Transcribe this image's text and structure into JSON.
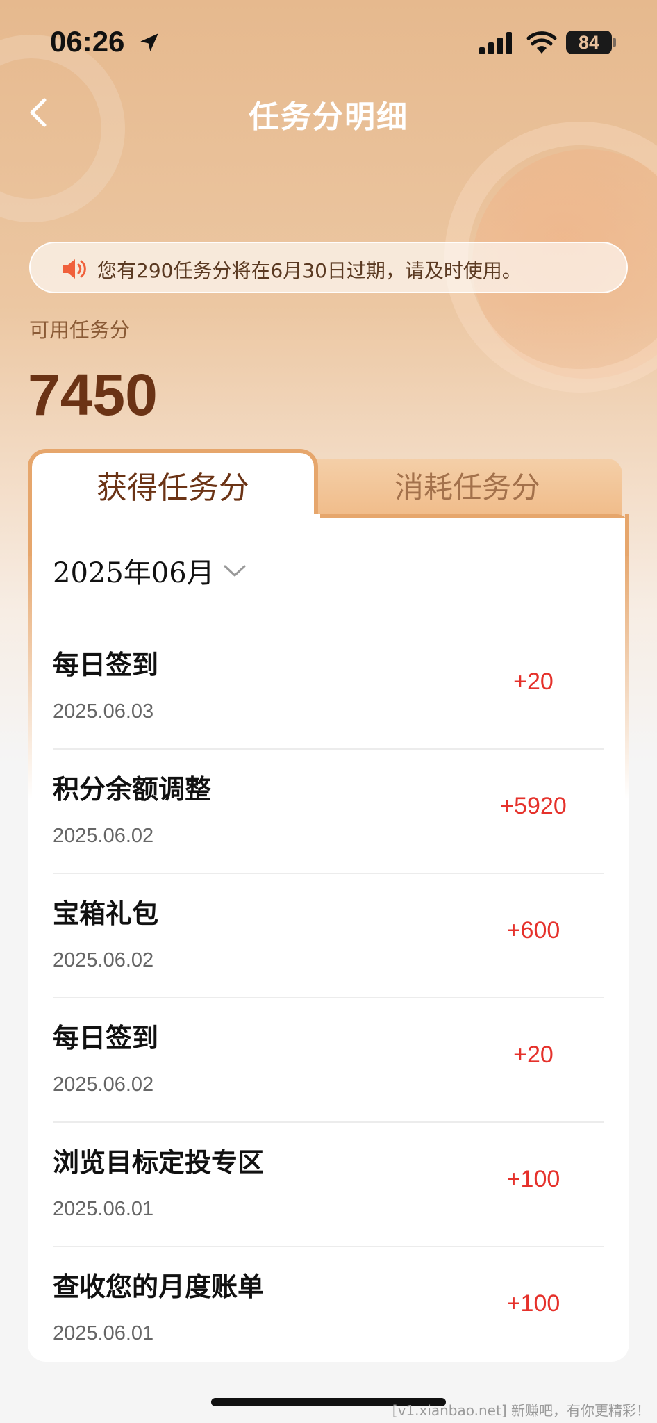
{
  "status_bar": {
    "time": "06:26",
    "battery": "84"
  },
  "nav": {
    "title": "任务分明细"
  },
  "notice": {
    "text": "您有290任务分将在6月30日过期，请及时使用。"
  },
  "balance": {
    "label": "可用任务分",
    "value": "7450"
  },
  "tabs": [
    {
      "label": "获得任务分",
      "active": true
    },
    {
      "label": "消耗任务分",
      "active": false
    }
  ],
  "filter": {
    "month": "2025年06月"
  },
  "records": [
    {
      "title": "每日签到",
      "date": "2025.06.03",
      "points": "+20"
    },
    {
      "title": "积分余额调整",
      "date": "2025.06.02",
      "points": "+5920"
    },
    {
      "title": "宝箱礼包",
      "date": "2025.06.02",
      "points": "+600"
    },
    {
      "title": "每日签到",
      "date": "2025.06.02",
      "points": "+20"
    },
    {
      "title": "浏览目标定投专区",
      "date": "2025.06.01",
      "points": "+100"
    },
    {
      "title": "查收您的月度账单",
      "date": "2025.06.01",
      "points": "+100"
    }
  ],
  "watermark": "[v1.xianbao.net] 新赚吧，有你更精彩！",
  "colors": {
    "accent": "#e6a66c",
    "points": "#e5312b",
    "balance": "#6b3315"
  }
}
